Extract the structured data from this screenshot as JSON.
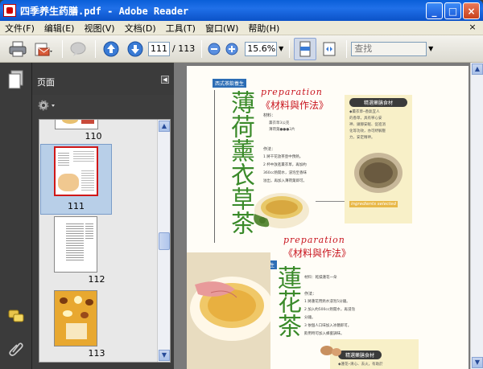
{
  "window": {
    "title": "四季养生药膳.pdf - Adobe Reader",
    "min_label": "_",
    "max_label": "□",
    "close_label": "×"
  },
  "menu": {
    "items": [
      "文件(F)",
      "编辑(E)",
      "视图(V)",
      "文档(D)",
      "工具(T)",
      "窗口(W)",
      "帮助(H)"
    ],
    "close_label": "×"
  },
  "toolbar": {
    "current_page": "111",
    "total_pages": "/ 113",
    "zoom": "15.6%",
    "find_placeholder": "查找"
  },
  "panel": {
    "title": "页面",
    "thumbnails": [
      {
        "label": "110"
      },
      {
        "label": "111"
      },
      {
        "label": "112"
      },
      {
        "label": "113"
      }
    ]
  },
  "document": {
    "top_tag": "西式茶飲養生",
    "section1_en": "preparation",
    "section1_zh": "《材料與作法》",
    "section1_title": "薄荷薰衣草茶",
    "section1_material_label": "材料：",
    "section1_material_items": [
      "薰衣草3公克",
      "薄荷葉●●●3片"
    ],
    "section1_method_label": "作法：",
    "section1_steps": [
      "1 將干花放茶壺中預熱。",
      "2 杯中放進薰衣草，再加約",
      "360cc熱開水，浸泡至香味",
      "溢出，再加入薄荷葉即可。"
    ],
    "section1_box_title": "精選藥膳食材",
    "section1_box_lines": [
      "◆薰衣草─香氣宜人",
      "的香草，具有寧心安",
      "神、鎮靜安眠、促進消",
      "化等功效，亦可紓解壓",
      "力，安定精神。"
    ],
    "section1_caption": "ingredients selected",
    "section2_tag": "芳香養生",
    "section2_en": "preparation",
    "section2_zh": "《材料與作法》",
    "section2_title": "蓮花茶",
    "section2_material": "材料：乾燥蓮花一朵",
    "section2_method_label": "作法：",
    "section2_steps": [
      "1 將蓮花用熱水浸泡5分鐘。",
      "2 加入約500cc熱開水，再浸泡",
      "分鐘。",
      "3 依個人口味加入冰糖即可。",
      "飲用時可加入蜂蜜調味。"
    ],
    "section2_box_title": "精選藥膳食材",
    "section2_box_line": "◆蓮花─清心、去火，有助於"
  },
  "colors": {
    "accent_red": "#c8141e",
    "title_green": "#3a8a2a",
    "tag_blue": "#2c6db5"
  }
}
